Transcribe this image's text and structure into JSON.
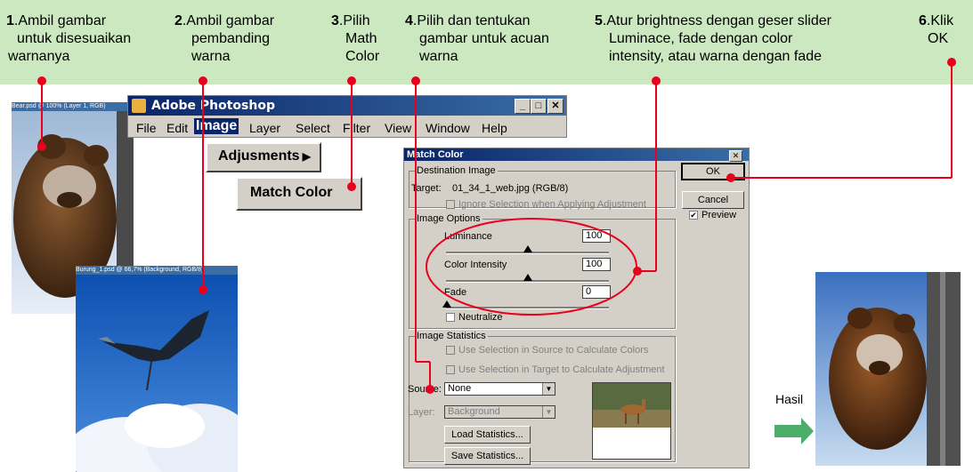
{
  "steps": [
    {
      "num": "1",
      "text1": ".Ambil gambar",
      "text2": "untuk disesuaikan",
      "text3": "warnanya"
    },
    {
      "num": "2",
      "text1": ".Ambil gambar",
      "text2": "pembanding",
      "text3": "warna"
    },
    {
      "num": "3",
      "text1": ".Pilih",
      "text2": "Math",
      "text3": "Color"
    },
    {
      "num": "4",
      "text1": ".Pilih dan tentukan",
      "text2": "gambar untuk acuan",
      "text3": "warna"
    },
    {
      "num": "5",
      "text1": ".Atur brightness dengan geser slider",
      "text2": "Luminace, fade dengan color",
      "text3": "intensity, atau warna dengan fade"
    },
    {
      "num": "6",
      "text1": ".Klik",
      "text2": "OK",
      "text3": ""
    }
  ],
  "photoshop": {
    "title": "Adobe Photoshop",
    "menu": [
      "File",
      "Edit",
      "Image",
      "Layer",
      "Select",
      "Filter",
      "View",
      "Window",
      "Help"
    ],
    "adjustments_label": "Adjusments",
    "match_color_label": "Match Color"
  },
  "doc_titles": {
    "bear": "Bear.psd @ 100% (Layer 1, RGB)",
    "heron": "Burung_1.psd @ 66,7% (Background, RGB/8)"
  },
  "dialog": {
    "title": "Match Color",
    "destination_group": "Destination Image",
    "target_label": "Target:",
    "target_value": "01_34_1_web.jpg (RGB/8)",
    "ignore_selection": "Ignore Selection when Applying Adjustment",
    "image_options_group": "Image Options",
    "luminance_label": "Luminance",
    "luminance_value": "100",
    "color_intensity_label": "Color Intensity",
    "color_intensity_value": "100",
    "fade_label": "Fade",
    "fade_value": "0",
    "neutralize_label": "Neutralize",
    "image_statistics_group": "Image Statistics",
    "use_sel_source": "Use Selection in Source to Calculate Colors",
    "use_sel_target": "Use Selection in Target to Calculate Adjustment",
    "source_label": "Source:",
    "source_value": "None",
    "layer_label": "Layer:",
    "layer_value": "Background",
    "load_stats": "Load Statistics...",
    "save_stats": "Save Statistics...",
    "ok": "OK",
    "cancel": "Cancel",
    "preview": "Preview"
  },
  "result_label": "Hasil",
  "colors": {
    "banner": "#cce8c0",
    "marker": "#e8001c",
    "arrow": "#4cae6a",
    "titlebar": "#0a246a"
  }
}
